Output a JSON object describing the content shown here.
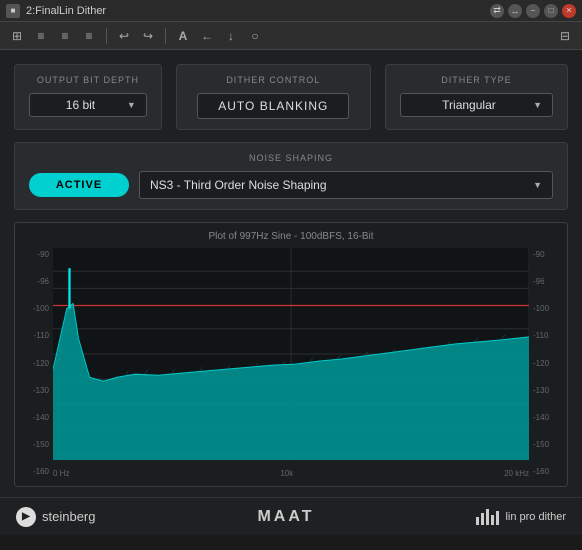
{
  "titleBar": {
    "title": "2:FinalLin Dither",
    "icon": "■",
    "controls": [
      "network",
      "arrow",
      "minimize",
      "maximize",
      "close"
    ]
  },
  "toolbar": {
    "icons": [
      "≡",
      "≡",
      "≡",
      "≡",
      "↩",
      "↪",
      "A",
      "←",
      "↓",
      "○"
    ]
  },
  "outputBitDepth": {
    "label": "OUTPUT BIT DEPTH",
    "value": "16 bit"
  },
  "ditherControl": {
    "label": "DITHER CONTROL",
    "value": "AUTO BLANKING"
  },
  "ditherType": {
    "label": "DITHER TYPE",
    "value": "Triangular"
  },
  "noiseShaping": {
    "label": "NOISE SHAPING",
    "activeButton": "ACTIVE",
    "nsValue": "NS3 - Third Order Noise Shaping"
  },
  "plot": {
    "title": "Plot of 997Hz Sine - 100dBFS, 16-Bit",
    "yLabels": [
      "-90",
      "-96",
      "-100",
      "-110",
      "-120",
      "-130",
      "-140",
      "-150",
      "-160"
    ],
    "xLabels": [
      "0 Hz",
      "10k",
      "20 kHz"
    ],
    "redLineY": "-100 dBFS"
  },
  "footer": {
    "steinberg": "steinberg",
    "maat": "MAAT",
    "linpro": "lin pro dither"
  }
}
